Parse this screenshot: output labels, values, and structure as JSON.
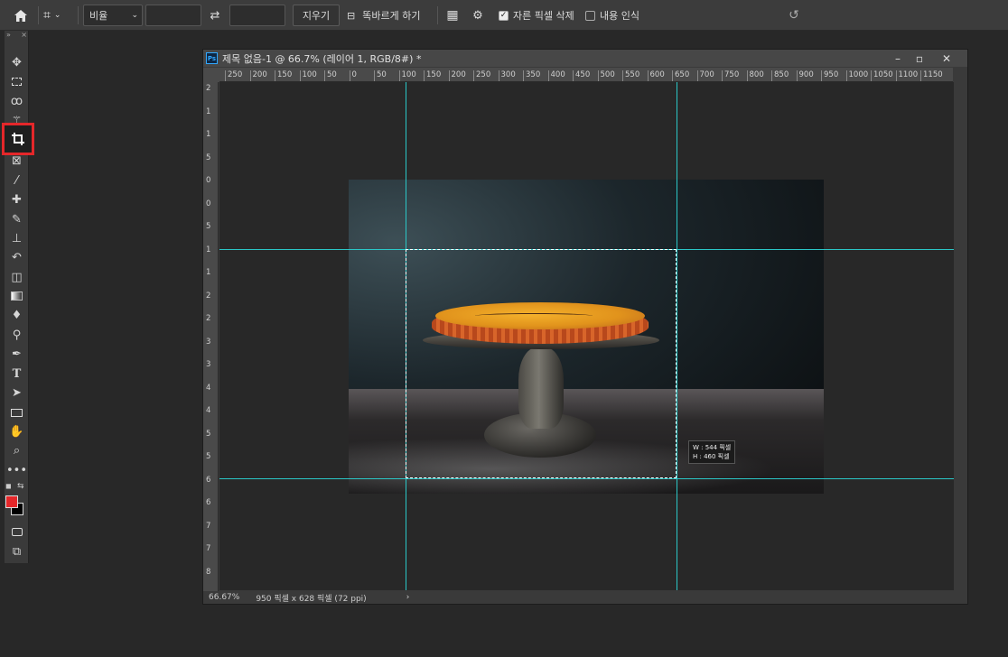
{
  "options": {
    "ratio": "비율",
    "ratio_w": "",
    "ratio_h": "",
    "clear": "지우기",
    "straighten": "똑바르게 하기",
    "delete_cropped": "자른 픽셀 삭제",
    "delete_cropped_checked": true,
    "content_aware": "내용 인식",
    "content_aware_checked": false
  },
  "tools": [
    "move-icon",
    "marquee-icon",
    "lasso-icon",
    "magic-wand-icon",
    "crop-icon",
    "frame-icon",
    "eyedropper-icon",
    "healing-icon",
    "brush-icon",
    "stamp-icon",
    "history-brush-icon",
    "eraser-icon",
    "gradient-icon",
    "blur-icon",
    "dodge-icon",
    "pen-icon",
    "type-icon",
    "path-select-icon",
    "rectangle-icon",
    "hand-icon",
    "zoom-icon",
    "more-icon"
  ],
  "colors": {
    "foreground": "#e5272a",
    "background": "#000000",
    "guide": "#2bc7c7",
    "highlight": "#e5272a"
  },
  "document": {
    "title": "제목 없음-1 @ 66.7% (레이어 1, RGB/8#) *",
    "zoom": "66.67%",
    "size_info": "950 픽셀 x 628 픽셀 (72 ppi)",
    "ruler_h": [
      "250",
      "200",
      "150",
      "100",
      "50",
      "0",
      "50",
      "100",
      "150",
      "200",
      "250",
      "300",
      "350",
      "400",
      "450",
      "500",
      "550",
      "600",
      "650",
      "700",
      "750",
      "800",
      "850",
      "900",
      "950",
      "1000",
      "1050",
      "1100",
      "1150"
    ],
    "ruler_v": [
      "2",
      "1",
      "1",
      "5",
      "0",
      "0",
      "5",
      "1",
      "1",
      "2",
      "2",
      "3",
      "3",
      "4",
      "4",
      "5",
      "5",
      "6",
      "6",
      "7",
      "7",
      "8"
    ],
    "crop_w": "W : 544 픽셀",
    "crop_h": "H : 460 픽셀"
  }
}
